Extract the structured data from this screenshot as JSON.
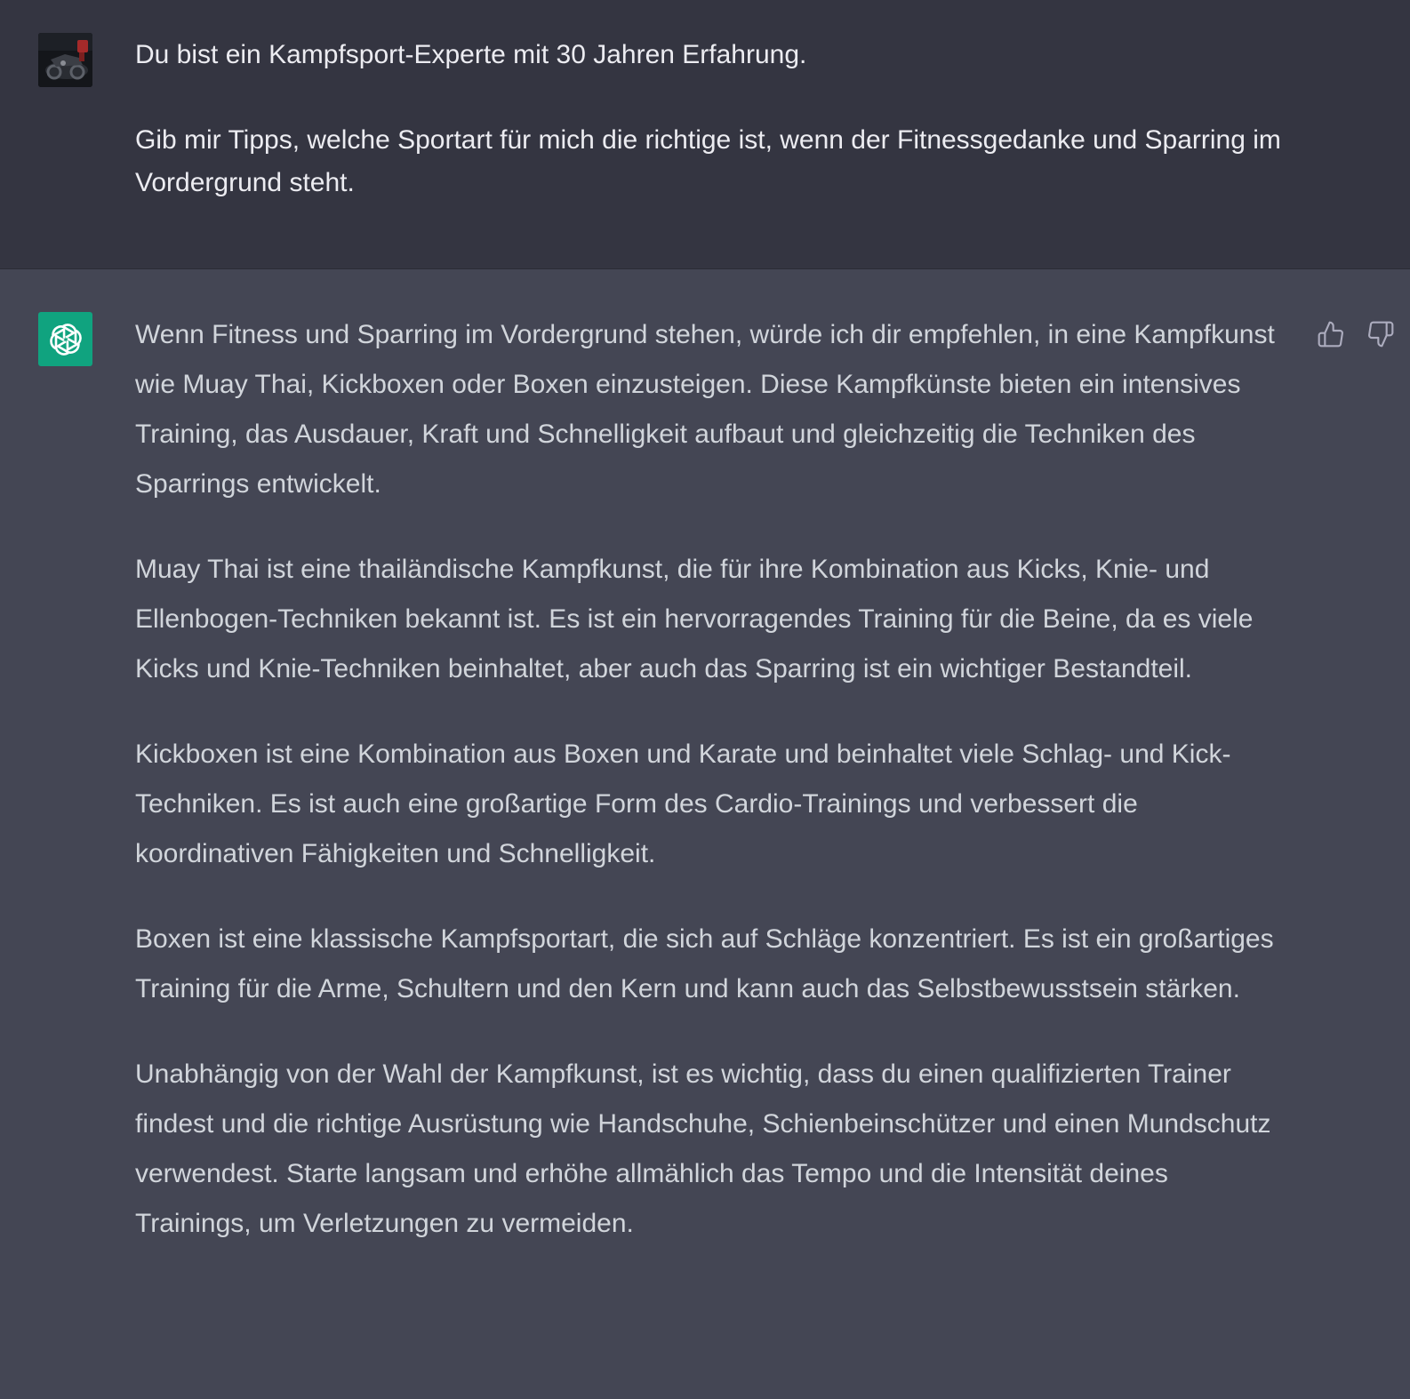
{
  "conversation": {
    "user_message": {
      "paragraphs": [
        "Du bist ein Kampfsport-Experte mit 30 Jahren Erfahrung.",
        "Gib mir Tipps, welche Sportart für mich die richtige ist, wenn der Fitnessgedanke und Sparring im Vordergrund steht."
      ]
    },
    "assistant_message": {
      "paragraphs": [
        "Wenn Fitness und Sparring im Vordergrund stehen, würde ich dir empfehlen, in eine Kampfkunst wie Muay Thai, Kickboxen oder Boxen einzusteigen. Diese Kampfkünste bieten ein intensives Training, das Ausdauer, Kraft und Schnelligkeit aufbaut und gleichzeitig die Techniken des Sparrings entwickelt.",
        "Muay Thai ist eine thailändische Kampfkunst, die für ihre Kombination aus Kicks, Knie- und Ellenbogen-Techniken bekannt ist. Es ist ein hervorragendes Training für die Beine, da es viele Kicks und Knie-Techniken beinhaltet, aber auch das Sparring ist ein wichtiger Bestandteil.",
        "Kickboxen ist eine Kombination aus Boxen und Karate und beinhaltet viele Schlag- und Kick-Techniken. Es ist auch eine großartige Form des Cardio-Trainings und verbessert die koordinativen Fähigkeiten und Schnelligkeit.",
        "Boxen ist eine klassische Kampfsportart, die sich auf Schläge konzentriert. Es ist ein großartiges Training für die Arme, Schultern und den Kern und kann auch das Selbstbewusstsein stärken.",
        "Unabhängig von der Wahl der Kampfkunst, ist es wichtig, dass du einen qualifizierten Trainer findest und die richtige Ausrüstung wie Handschuhe, Schienbeinschützer und einen Mundschutz verwendest. Starte langsam und erhöhe allmählich das Tempo und die Intensität deines Trainings, um Verletzungen zu vermeiden."
      ],
      "feedback_icons": [
        "thumbs-up-icon",
        "thumbs-down-icon"
      ]
    }
  },
  "colors": {
    "user_bg": "#343541",
    "assistant_bg": "#444654",
    "bot_avatar": "#10a37f",
    "user_text": "#ececf1",
    "assistant_text": "#d1d5db",
    "icon": "#acacbe"
  },
  "icons": {
    "user_avatar": "user-avatar-photo",
    "bot_avatar": "openai-logo-icon"
  }
}
